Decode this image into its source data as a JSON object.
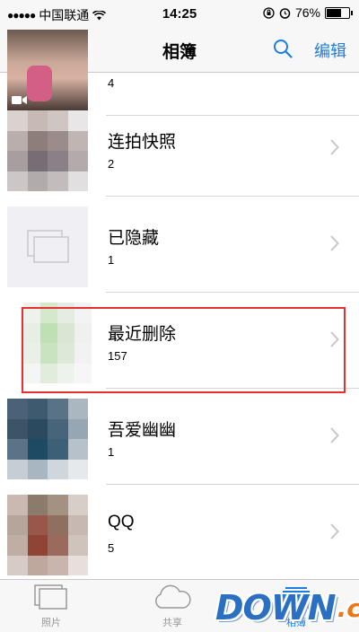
{
  "status_bar": {
    "carrier": "中国联通",
    "time": "14:25",
    "battery": "76%",
    "battery_level": 0.76
  },
  "nav": {
    "add_icon": "plus-icon",
    "title": "相簿",
    "search_icon": "search-icon",
    "edit_label": "编辑"
  },
  "albums": [
    {
      "title": "",
      "count": "4"
    },
    {
      "title": "连拍快照",
      "count": "2"
    },
    {
      "title": "已隐藏",
      "count": "1"
    },
    {
      "title": "最近删除",
      "count": "157"
    },
    {
      "title": "吾爱幽幽",
      "count": "1"
    },
    {
      "title": "QQ",
      "count": "5"
    }
  ],
  "tabs": [
    {
      "label": "照片",
      "icon": "photos-icon"
    },
    {
      "label": "共享",
      "icon": "cloud-icon"
    },
    {
      "label": "相簿",
      "icon": "albums-icon"
    }
  ],
  "watermark": {
    "down": "DOWN",
    "cc": ".cc"
  },
  "colors": {
    "accent": "#1b7de0",
    "highlight": "#e5302f"
  }
}
